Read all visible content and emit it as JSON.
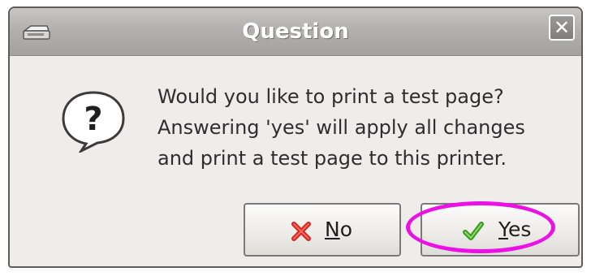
{
  "window": {
    "title": "Question",
    "close_label": "✕"
  },
  "message": {
    "lines": [
      "Would you like to print a test page?",
      "Answering 'yes' will apply all changes",
      "and print a test page to this printer."
    ]
  },
  "buttons": {
    "no": {
      "mnemonic": "N",
      "rest": "o",
      "icon": "red-x-icon"
    },
    "yes": {
      "mnemonic": "Y",
      "rest": "es",
      "icon": "green-check-icon"
    }
  },
  "annotation": {
    "highlight_color": "#ec0fe6"
  },
  "colors": {
    "titlebar": "#b0afab",
    "dialog_bg": "#eeede9",
    "no_icon": "#d9231c",
    "yes_icon": "#3a9a1e"
  }
}
